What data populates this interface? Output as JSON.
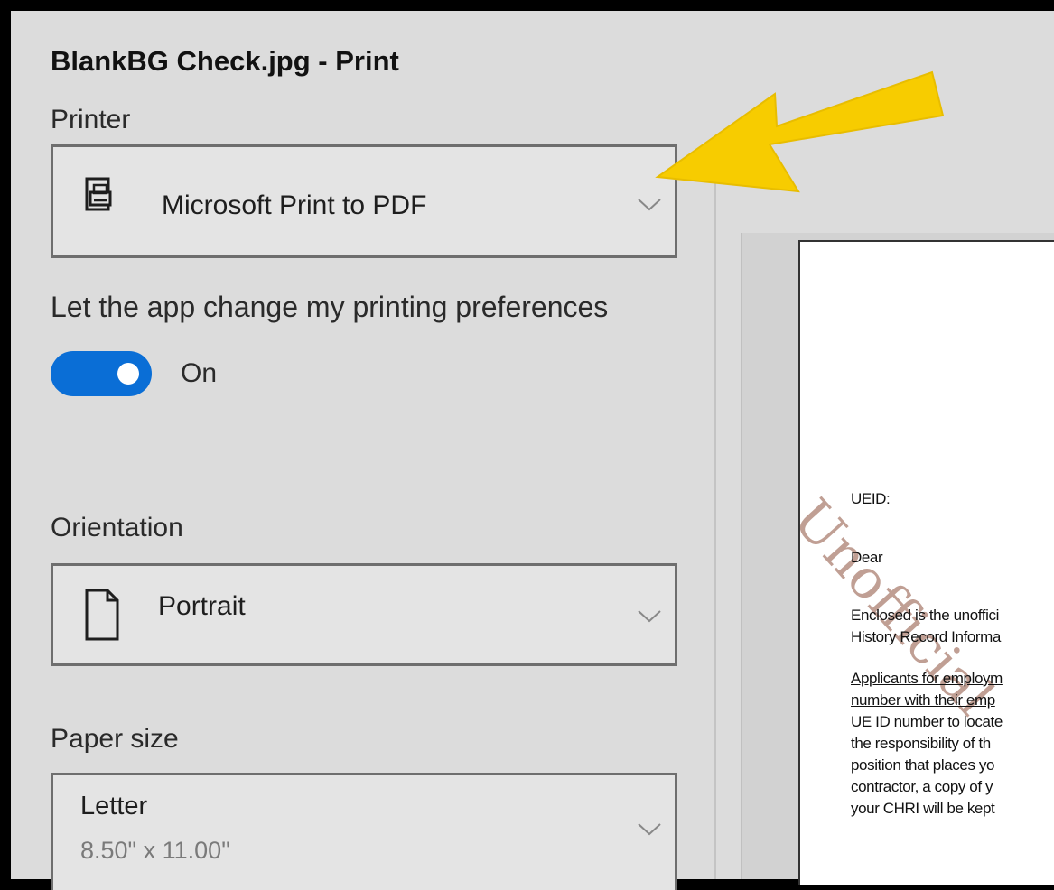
{
  "window": {
    "title": "BlankBG Check.jpg - Print"
  },
  "printer": {
    "label": "Printer",
    "selected": "Microsoft Print to PDF",
    "icon": "printer-icon"
  },
  "preferences": {
    "label": "Let the app change my printing preferences",
    "toggle_state": "On"
  },
  "orientation": {
    "label": "Orientation",
    "selected": "Portrait",
    "icon": "portrait-page-icon"
  },
  "paper_size": {
    "label": "Paper size",
    "selected": "Letter",
    "dimensions": "8.50\" x 11.00\""
  },
  "preview": {
    "watermark": "Unofficial",
    "lines": [
      "UEID:",
      "Dear",
      "Enclosed is the unoffici",
      "History Record Informa",
      "Applicants for employm",
      "number with their emp",
      "UE ID number to locate",
      "the responsibility of th",
      "position that places yo",
      "contractor, a copy of y",
      "your CHRI will be kept"
    ]
  },
  "colors": {
    "toggle_on": "#0a6ed6",
    "annotation_arrow": "#f7cc00",
    "watermark": "#8c503c"
  }
}
